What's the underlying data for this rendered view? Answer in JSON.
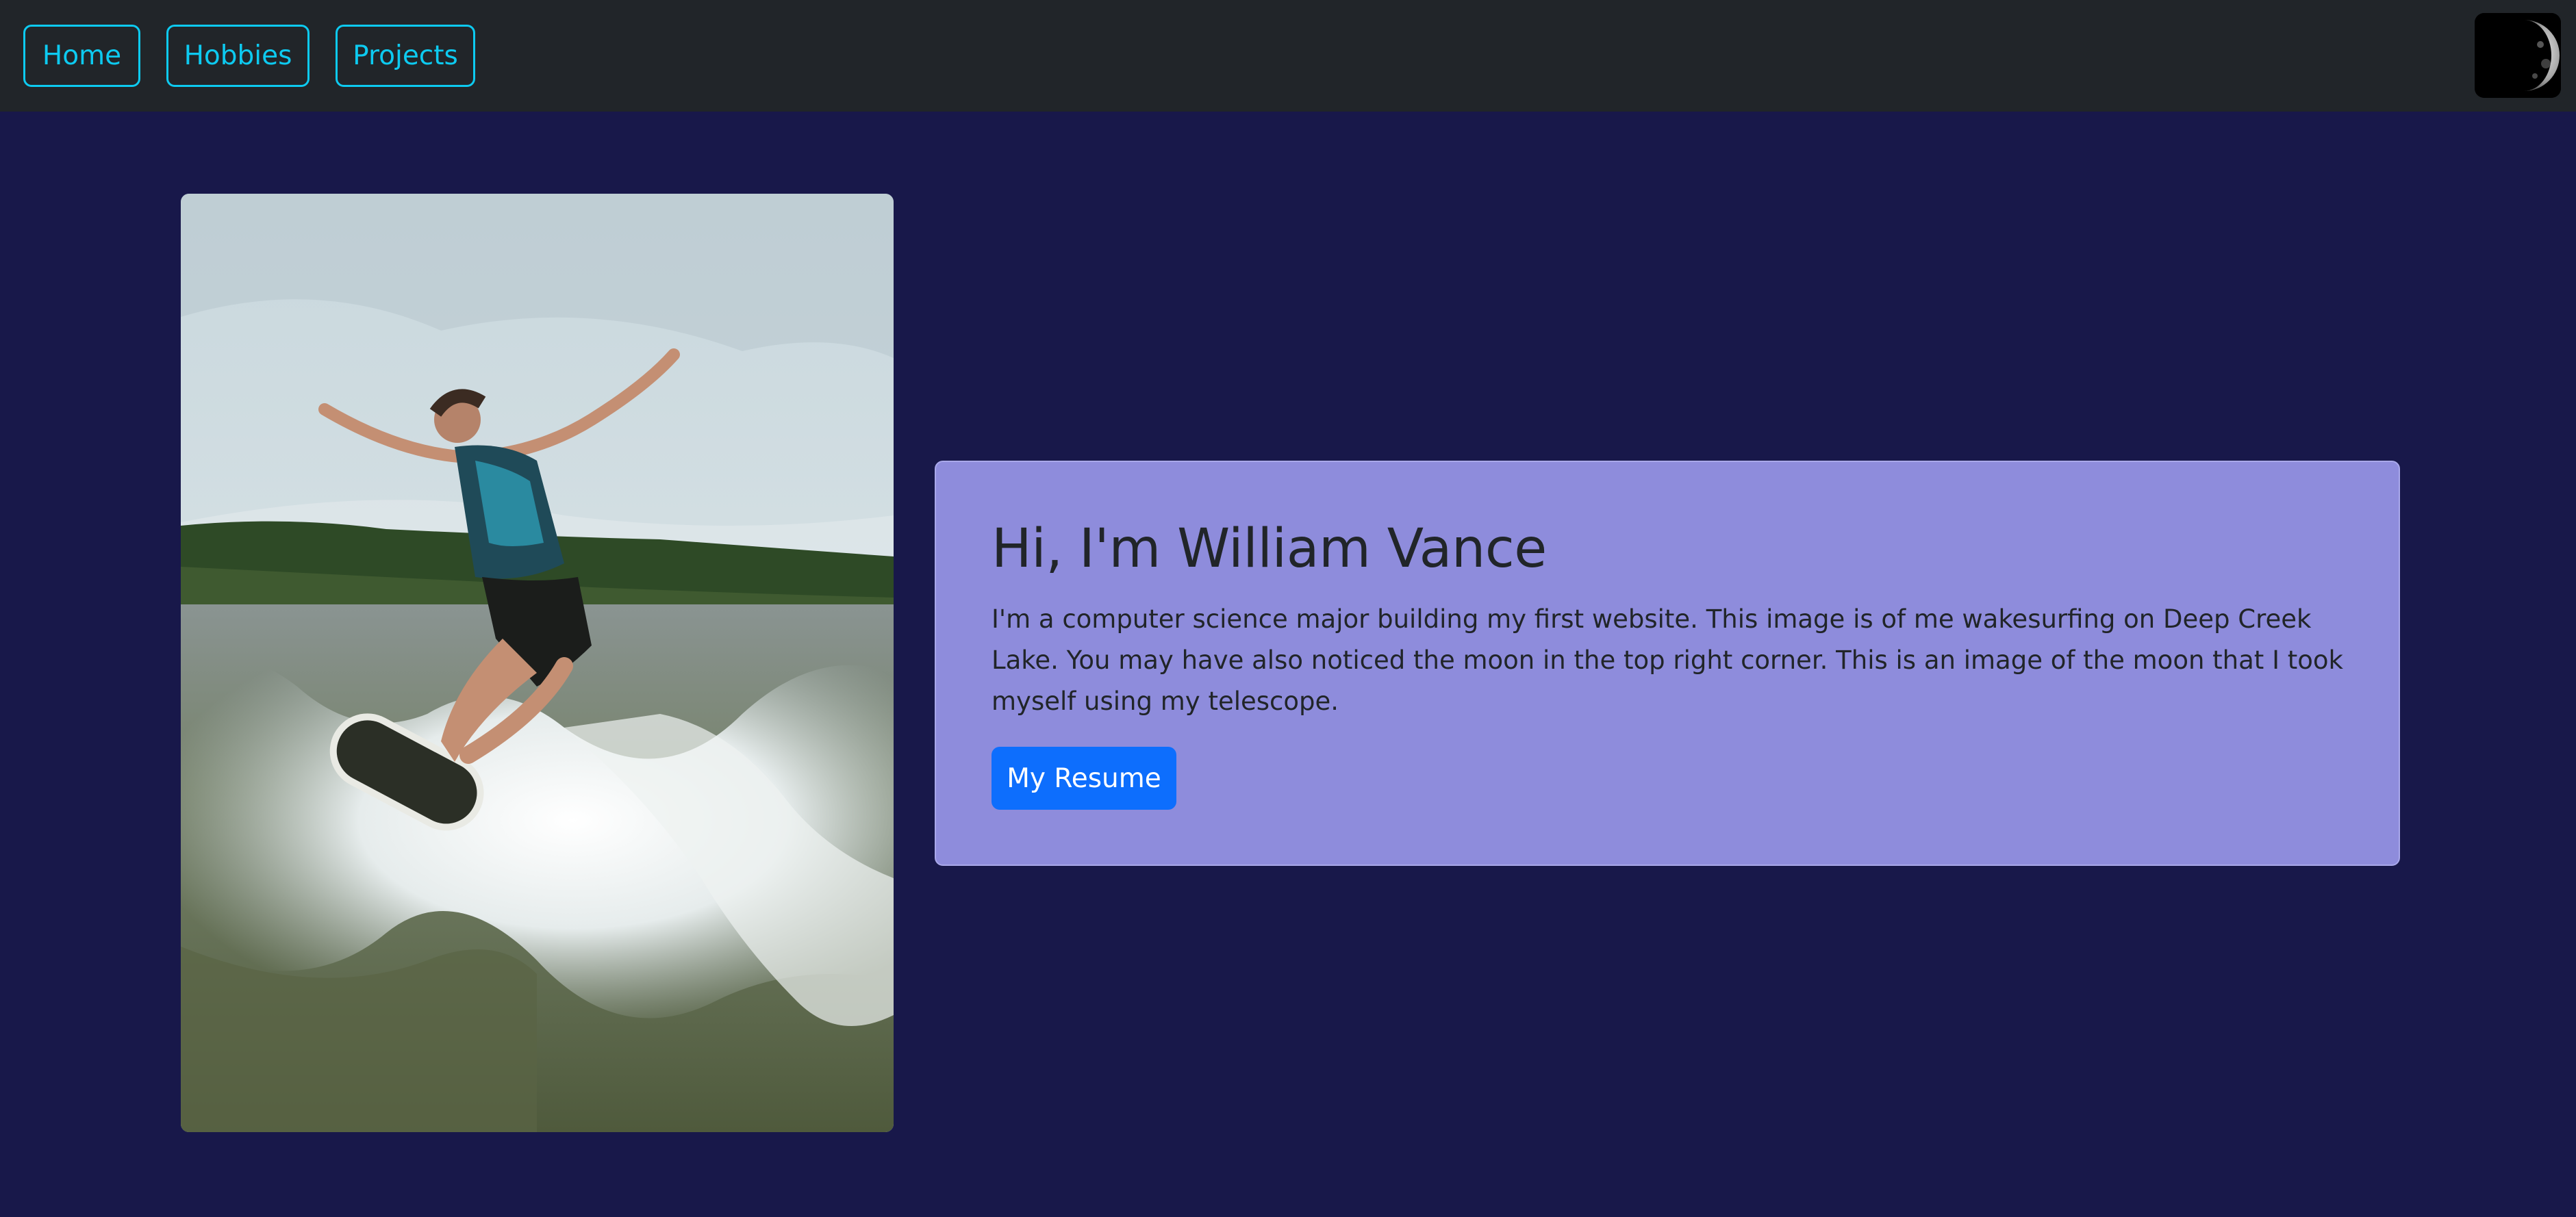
{
  "nav": {
    "items": [
      {
        "label": "Home"
      },
      {
        "label": "Hobbies"
      },
      {
        "label": "Projects"
      }
    ],
    "accent_color": "#0dcaf0",
    "background_color": "#212529"
  },
  "moon_image": {
    "icon": "moon-icon"
  },
  "hero_photo": {
    "subject": "wakesurfing-photo"
  },
  "intro": {
    "heading": "Hi, I'm William Vance",
    "body": "I'm a computer science major building my first website. This image is of me wakesurfing on Deep Creek Lake. You may have also noticed the moon in the top right corner. This is an image of the moon that I took myself using my telescope.",
    "button_label": "My Resume",
    "card_color": "#8e8cdc",
    "button_color": "#0d6efd"
  },
  "page": {
    "background_color": "#18184a"
  }
}
